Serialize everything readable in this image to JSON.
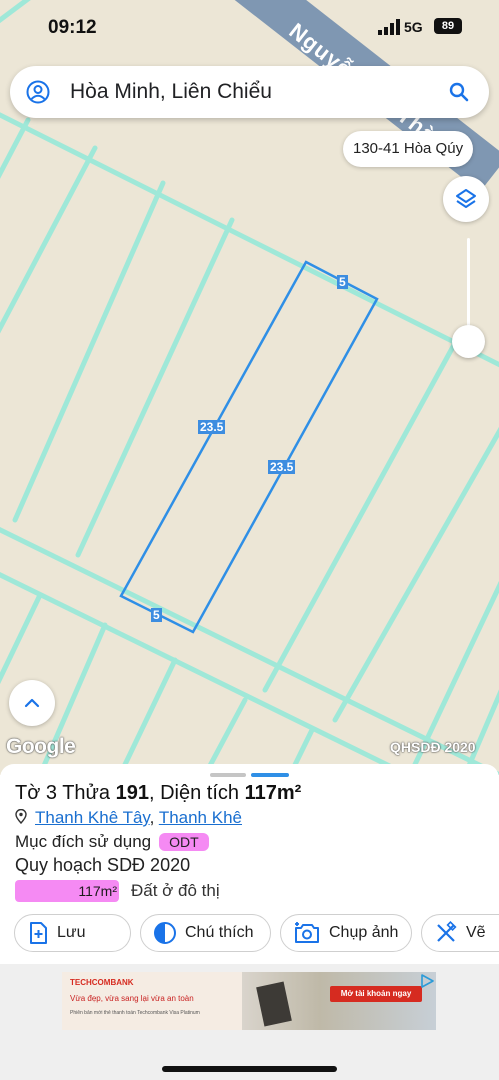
{
  "status_bar": {
    "time": "09:12",
    "network": "5G",
    "battery": "89"
  },
  "map": {
    "road_name": "Nguyễn Tất Thành",
    "search": {
      "query": "Hòa Minh, Liên Chiểu"
    },
    "place_chip": "130-41 Hòa Qúy",
    "dimension_labels": {
      "top": "5",
      "left": "23.5",
      "right": "23.5",
      "bottom": "5"
    },
    "logo": "Google",
    "layer_label": "QHSDĐ 2020",
    "colors": {
      "parcel_outline": "#2f8fe6",
      "boundary_lines": "#9fe8d8",
      "background": "#ece6d6"
    }
  },
  "sheet": {
    "title": {
      "prefix": "Tờ 3 Thửa ",
      "parcel_no": "191",
      "mid": ", Diện tích ",
      "area": "117m²"
    },
    "location": {
      "ward": "Thanh Khê Tây",
      "separator": ", ",
      "district": "Thanh Khê"
    },
    "purpose_label": "Mục đích sử dụng",
    "purpose_code": "ODT",
    "plan_label": "Quy hoạch SDĐ 2020",
    "legend": {
      "value": "117m²",
      "description": "Đất ở đô thị",
      "color": "#f58af3"
    },
    "actions": [
      {
        "label": "Lưu",
        "icon": "add-bookmark-icon"
      },
      {
        "label": "Chú thích",
        "icon": "contrast-icon"
      },
      {
        "label": "Chụp ảnh",
        "icon": "camera-icon"
      },
      {
        "label": "Vẽ",
        "icon": "draw-tools-icon"
      }
    ]
  },
  "ad": {
    "brand": "TECHCOMBANK",
    "headline": "Vừa đẹp, vừa sang lại vừa an toàn",
    "subline": "Phiên bản mới thẻ thanh toán Techcombank Visa Platinum",
    "cta": "Mở tài khoản ngay"
  }
}
